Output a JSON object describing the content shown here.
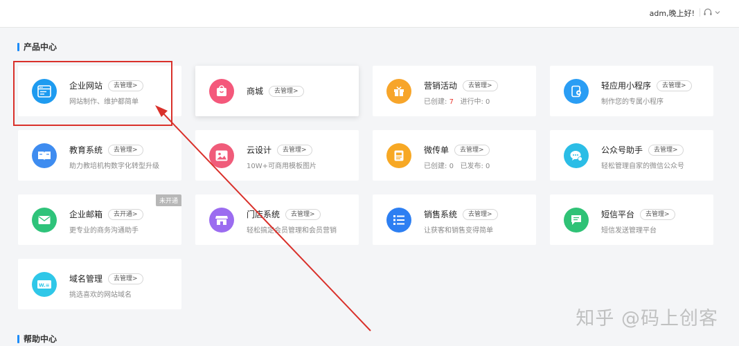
{
  "header": {
    "greeting": "adm,晚上好!",
    "support_icon": "headset-icon",
    "dropdown_icon": "chevron-down-icon"
  },
  "sections": {
    "products_title": "产品中心",
    "help_title": "帮助中心"
  },
  "cards": [
    {
      "id": "website",
      "name": "企业网站",
      "action": "去管理>",
      "desc": "网站制作、维护都简单",
      "icon": "browser-window-icon",
      "color": "#1e9bf0"
    },
    {
      "id": "mall",
      "name": "商城",
      "action": "去管理>",
      "desc": "",
      "icon": "shopping-bag-icon",
      "color": "#f4587b"
    },
    {
      "id": "marketing",
      "name": "营销活动",
      "action": "去管理>",
      "desc_created_label": "已创建:",
      "desc_created_value": "7",
      "desc_running_label": "进行中:",
      "desc_running_value": "0",
      "icon": "gift-icon",
      "color": "#f7a52a"
    },
    {
      "id": "miniapp",
      "name": "轻应用小程序",
      "action": "去管理>",
      "desc": "制作您的专属小程序",
      "icon": "mini-program-icon",
      "color": "#2a9df4"
    },
    {
      "id": "education",
      "name": "教育系统",
      "action": "去管理>",
      "desc": "助力教培机构数字化转型升级",
      "icon": "book-icon",
      "color": "#3e8cf0"
    },
    {
      "id": "clouddesign",
      "name": "云设计",
      "action": "去管理>",
      "desc": "10W+可商用模板图片",
      "icon": "image-icon",
      "color": "#f05c7a"
    },
    {
      "id": "flyer",
      "name": "微传单",
      "action": "去管理>",
      "desc_created_label": "已创建:",
      "desc_created_value": "0",
      "desc_published_label": "已发布:",
      "desc_published_value": "0",
      "icon": "flyer-icon",
      "color": "#f7a824"
    },
    {
      "id": "wechat",
      "name": "公众号助手",
      "action": "去管理>",
      "desc": "轻松管理自家的微信公众号",
      "icon": "wechat-bubble-icon",
      "color": "#2bbde6"
    },
    {
      "id": "email",
      "name": "企业邮箱",
      "action": "去开通>",
      "desc": "更专业的商务沟通助手",
      "badge": "未开通",
      "icon": "mail-icon",
      "color": "#2ec37a"
    },
    {
      "id": "store",
      "name": "门店系统",
      "action": "去管理>",
      "desc": "轻松搞定会员管理和会员营销",
      "icon": "storefront-icon",
      "color": "#9b6cf0"
    },
    {
      "id": "sales",
      "name": "销售系统",
      "action": "去管理>",
      "desc": "让获客和销售变得简单",
      "icon": "list-icon",
      "color": "#2d7ff2"
    },
    {
      "id": "sms",
      "name": "短信平台",
      "action": "去管理>",
      "desc": "短信发送管理平台",
      "icon": "message-icon",
      "color": "#2fc276"
    },
    {
      "id": "domain",
      "name": "域名管理",
      "action": "去管理>",
      "desc": "挑选喜欢的网站域名",
      "icon": "domain-icon",
      "color": "#2fc7e8"
    }
  ],
  "watermark": "知乎 @码上创客",
  "colors": {
    "accent": "#1d8cf8",
    "annotation": "#d9302a"
  }
}
